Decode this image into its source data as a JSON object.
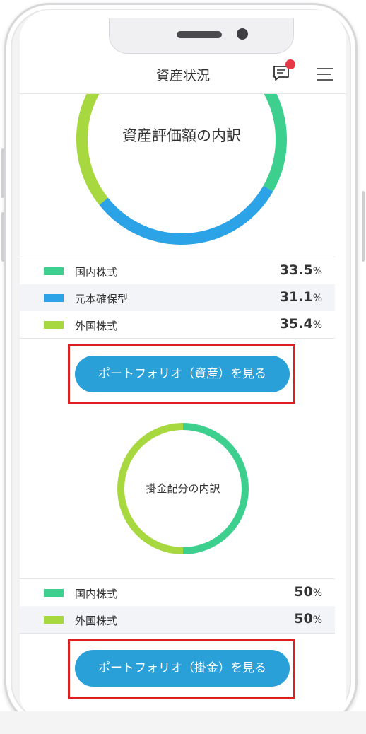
{
  "header": {
    "title": "資産状況"
  },
  "asset_chart": {
    "center_label": "資産評価額の内訳",
    "legend": [
      {
        "label": "国内株式",
        "value": "33.5",
        "unit": "%",
        "color": "#3ccf8e"
      },
      {
        "label": "元本確保型",
        "value": "31.1",
        "unit": "%",
        "color": "#2ba3e6"
      },
      {
        "label": "外国株式",
        "value": "35.4",
        "unit": "%",
        "color": "#a8d83f"
      }
    ],
    "button_label": "ポートフォリオ（資産）を見る"
  },
  "contribution_chart": {
    "center_label": "掛金配分の内訳",
    "legend": [
      {
        "label": "国内株式",
        "value": "50",
        "unit": "%",
        "color": "#3ccf8e"
      },
      {
        "label": "外国株式",
        "value": "50",
        "unit": "%",
        "color": "#a8d83f"
      }
    ],
    "button_label": "ポートフォリオ（掛金）を見る"
  },
  "chart_data": [
    {
      "type": "pie",
      "title": "資産評価額の内訳",
      "categories": [
        "国内株式",
        "元本確保型",
        "外国株式"
      ],
      "values": [
        33.5,
        31.1,
        35.4
      ]
    },
    {
      "type": "pie",
      "title": "掛金配分の内訳",
      "categories": [
        "国内株式",
        "外国株式"
      ],
      "values": [
        50,
        50
      ]
    }
  ]
}
